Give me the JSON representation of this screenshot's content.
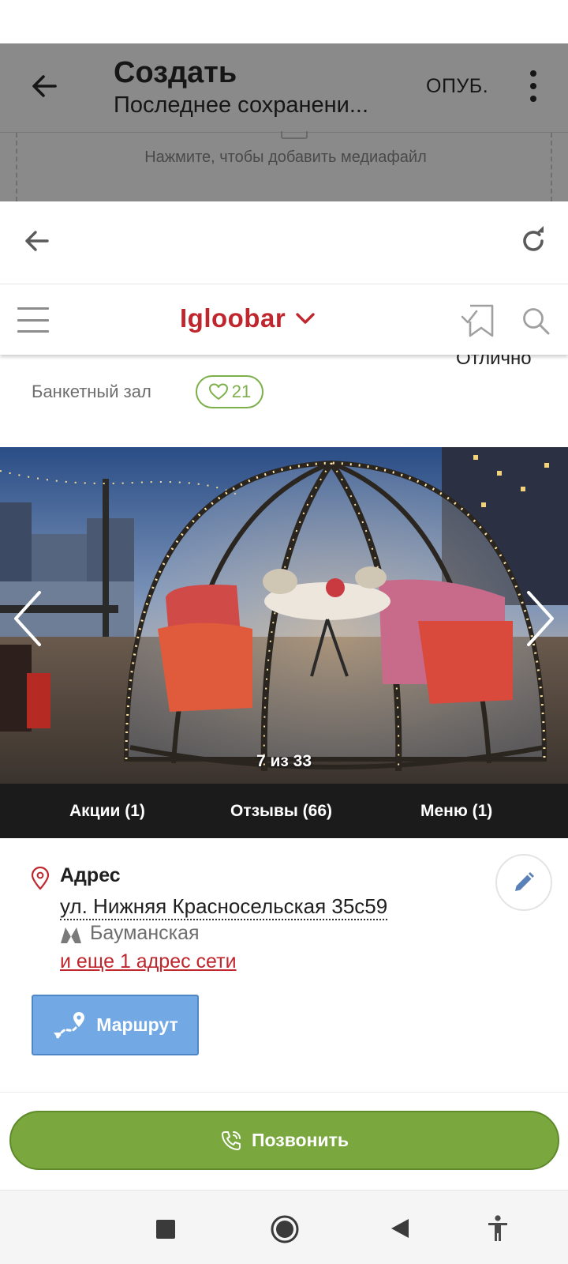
{
  "editor": {
    "title": "Создать",
    "subtitle": "Последнее сохранени...",
    "publish_label": "ОПУБ.",
    "media_hint": "Нажмите, чтобы добавить медиафайл"
  },
  "site": {
    "logo": "Igloobar"
  },
  "venue": {
    "rating_label": "Отлично",
    "type": "Банкетный зал",
    "likes": "21"
  },
  "gallery": {
    "counter": "7 из 33",
    "current_index": 7,
    "total": 33
  },
  "tabs": [
    {
      "label": "Акции (1)"
    },
    {
      "label": "Отзывы (66)"
    },
    {
      "label": "Меню (1)"
    }
  ],
  "address": {
    "heading": "Адрес",
    "street": "ул. Нижняя Красносельская 35с59",
    "metro": "Бауманская",
    "more_link": "и еще 1 адрес сети"
  },
  "buttons": {
    "route": "Маршрут",
    "call": "Позвонить"
  },
  "colors": {
    "brand_red": "#c0262d",
    "call_green": "#7aa83f",
    "route_blue": "#72a9e4",
    "tabs_bg": "#1b1b1b",
    "like_green": "#7db04a"
  },
  "icons": {
    "editor_back": "arrow-left-icon",
    "editor_more": "more-vert-icon",
    "browser_back": "arrow-left-icon",
    "browser_reload": "reload-icon",
    "menu": "hamburger-icon",
    "logo_dropdown": "chevron-down-icon",
    "bookmark": "bookmark-check-icon",
    "search": "search-icon",
    "like": "heart-icon",
    "pin": "map-pin-icon",
    "metro": "metro-icon",
    "edit": "pencil-icon",
    "route": "route-icon",
    "phone": "phone-icon"
  }
}
